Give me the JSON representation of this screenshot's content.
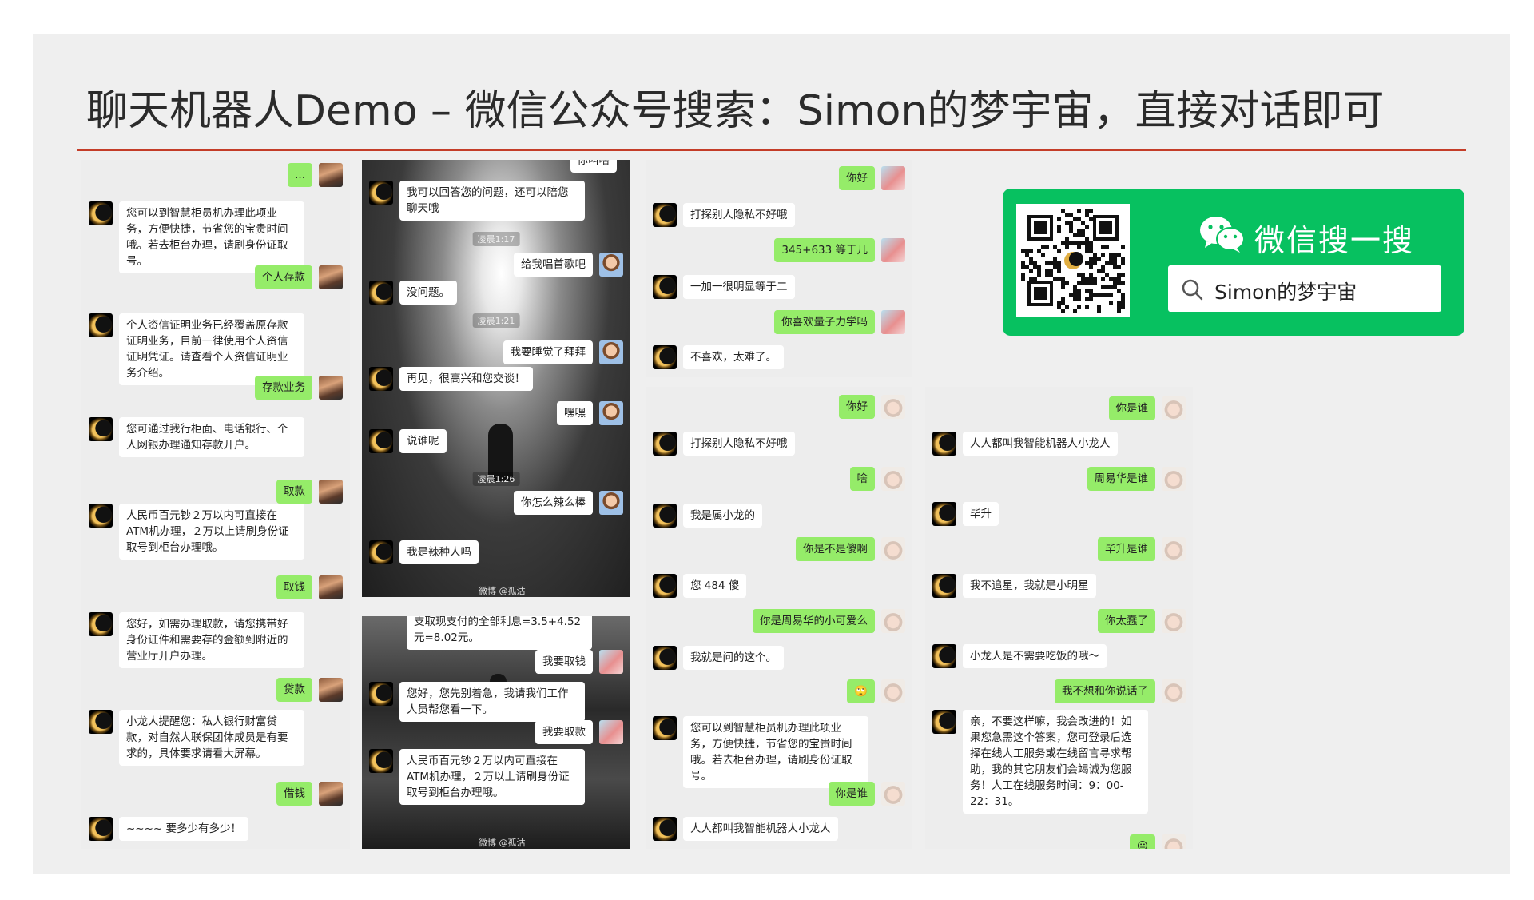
{
  "slide": {
    "title": "聊天机器人Demo – 微信公众号搜索：Simon的梦宇宙，直接对话即可"
  },
  "wechat_search": {
    "label": "微信搜一搜",
    "query": "Simon的梦宇宙"
  },
  "colors": {
    "accent_rule": "#c43d28",
    "wechat_green": "#07c160",
    "bubble_green": "#95ec69"
  },
  "panel1": {
    "messages": [
      {
        "from": "user",
        "text": "..."
      },
      {
        "from": "bot",
        "text": "您可以到智慧柜员机办理此项业务，方便快捷，节省您的宝贵时间哦。若去柜台办理，请刷身份证取号。"
      },
      {
        "from": "user",
        "text": "个人存款"
      },
      {
        "from": "bot",
        "text": "个人资信证明业务已经覆盖原存款证明业务，目前一律使用个人资信证明凭证。请查看个人资信证明业务介绍。"
      },
      {
        "from": "user",
        "text": "存款业务"
      },
      {
        "from": "bot",
        "text": "您可通过我行柜面、电话银行、个人网银办理通知存款开户。"
      },
      {
        "from": "user",
        "text": "取款"
      },
      {
        "from": "bot",
        "text": "人民币百元钞２万以内可直接在ATM机办理，２万以上请刷身份证取号到柜台办理哦。"
      },
      {
        "from": "user",
        "text": "取钱"
      },
      {
        "from": "bot",
        "text": "您好，如需办理取款，请您携带好身份证件和需要存的金额到附近的营业厅开户办理。"
      },
      {
        "from": "user",
        "text": "贷款"
      },
      {
        "from": "bot",
        "text": "小龙人提醒您：私人银行财富贷款，对自然人联保团体成员是有要求的，具体要求请看大屏幕。"
      },
      {
        "from": "user",
        "text": "借钱"
      },
      {
        "from": "bot",
        "text": "~~~~ 要多少有多少！"
      }
    ]
  },
  "panel2": {
    "top_partial": "你叫啥",
    "messages": [
      {
        "from": "bot",
        "text": "我可以回答您的问题，还可以陪您聊天哦"
      },
      {
        "from": "time",
        "text": "凌晨1:17"
      },
      {
        "from": "user",
        "text": "给我唱首歌吧"
      },
      {
        "from": "bot",
        "text": "没问题。"
      },
      {
        "from": "time",
        "text": "凌晨1:21"
      },
      {
        "from": "user",
        "text": "我要睡觉了拜拜"
      },
      {
        "from": "bot",
        "text": "再见，很高兴和您交谈！"
      },
      {
        "from": "user",
        "text": "嘿嘿"
      },
      {
        "from": "bot",
        "text": "说谁呢"
      },
      {
        "from": "time",
        "text": "凌晨1:26"
      },
      {
        "from": "user",
        "text": "你怎么辣么棒"
      },
      {
        "from": "bot",
        "text": "我是辣种人吗"
      }
    ],
    "watermark": "微博 @孤沽"
  },
  "panel3": {
    "top_partial": "支取现支付的全部利息=3.5+4.52元=8.02元。",
    "messages": [
      {
        "from": "user",
        "text": "我要取钱"
      },
      {
        "from": "bot",
        "text": "您好，您先别着急，我请我们工作人员帮您看一下。"
      },
      {
        "from": "user",
        "text": "我要取款"
      },
      {
        "from": "bot",
        "text": "人民币百元钞２万以内可直接在ATM机办理，２万以上请刷身份证取号到柜台办理哦。"
      }
    ],
    "watermark": "微博 @孤沽"
  },
  "panel4": {
    "messages": [
      {
        "from": "user",
        "text": "你好"
      },
      {
        "from": "bot",
        "text": "打探别人隐私不好哦"
      },
      {
        "from": "user",
        "text": "345+633 等于几"
      },
      {
        "from": "bot",
        "text": "一加一很明显等于二"
      },
      {
        "from": "user",
        "text": "你喜欢量子力学吗"
      },
      {
        "from": "bot",
        "text": "不喜欢，太难了。"
      }
    ]
  },
  "panel5": {
    "messages": [
      {
        "from": "user",
        "text": "你好"
      },
      {
        "from": "bot",
        "text": "打探别人隐私不好哦"
      },
      {
        "from": "user",
        "text": "啥"
      },
      {
        "from": "bot",
        "text": "我是属小龙的"
      },
      {
        "from": "user",
        "text": "你是不是傻啊"
      },
      {
        "from": "bot",
        "text": "您 484 傻"
      },
      {
        "from": "user",
        "text": "你是周易华的小可爱么"
      },
      {
        "from": "bot",
        "text": "我就是问的这个。"
      },
      {
        "from": "user",
        "text": "🙄"
      },
      {
        "from": "bot",
        "text": "您可以到智慧柜员机办理此项业务，方便快捷，节省您的宝贵时间哦。若去柜台办理，请刷身份证取号。"
      },
      {
        "from": "user",
        "text": "你是谁"
      },
      {
        "from": "bot",
        "text": "人人都叫我智能机器人小龙人"
      }
    ]
  },
  "panel6": {
    "messages": [
      {
        "from": "user",
        "text": "你是谁"
      },
      {
        "from": "bot",
        "text": "人人都叫我智能机器人小龙人"
      },
      {
        "from": "user",
        "text": "周易华是谁"
      },
      {
        "from": "bot",
        "text": "毕升"
      },
      {
        "from": "user",
        "text": "毕升是谁"
      },
      {
        "from": "bot",
        "text": "我不追星，我就是小明星"
      },
      {
        "from": "user",
        "text": "你太蠢了"
      },
      {
        "from": "bot",
        "text": "小龙人是不需要吃饭的哦～"
      },
      {
        "from": "user",
        "text": "我不想和你说话了"
      },
      {
        "from": "bot",
        "text": "亲，不要这样嘛，我会改进的！如果您急需这个答案，您可登录后选择在线人工服务或在线留言寻求帮助，我的其它朋友们会竭诚为您服务！人工在线服务时间：9：00-22：31。"
      },
      {
        "from": "user",
        "text": "😐"
      }
    ]
  }
}
